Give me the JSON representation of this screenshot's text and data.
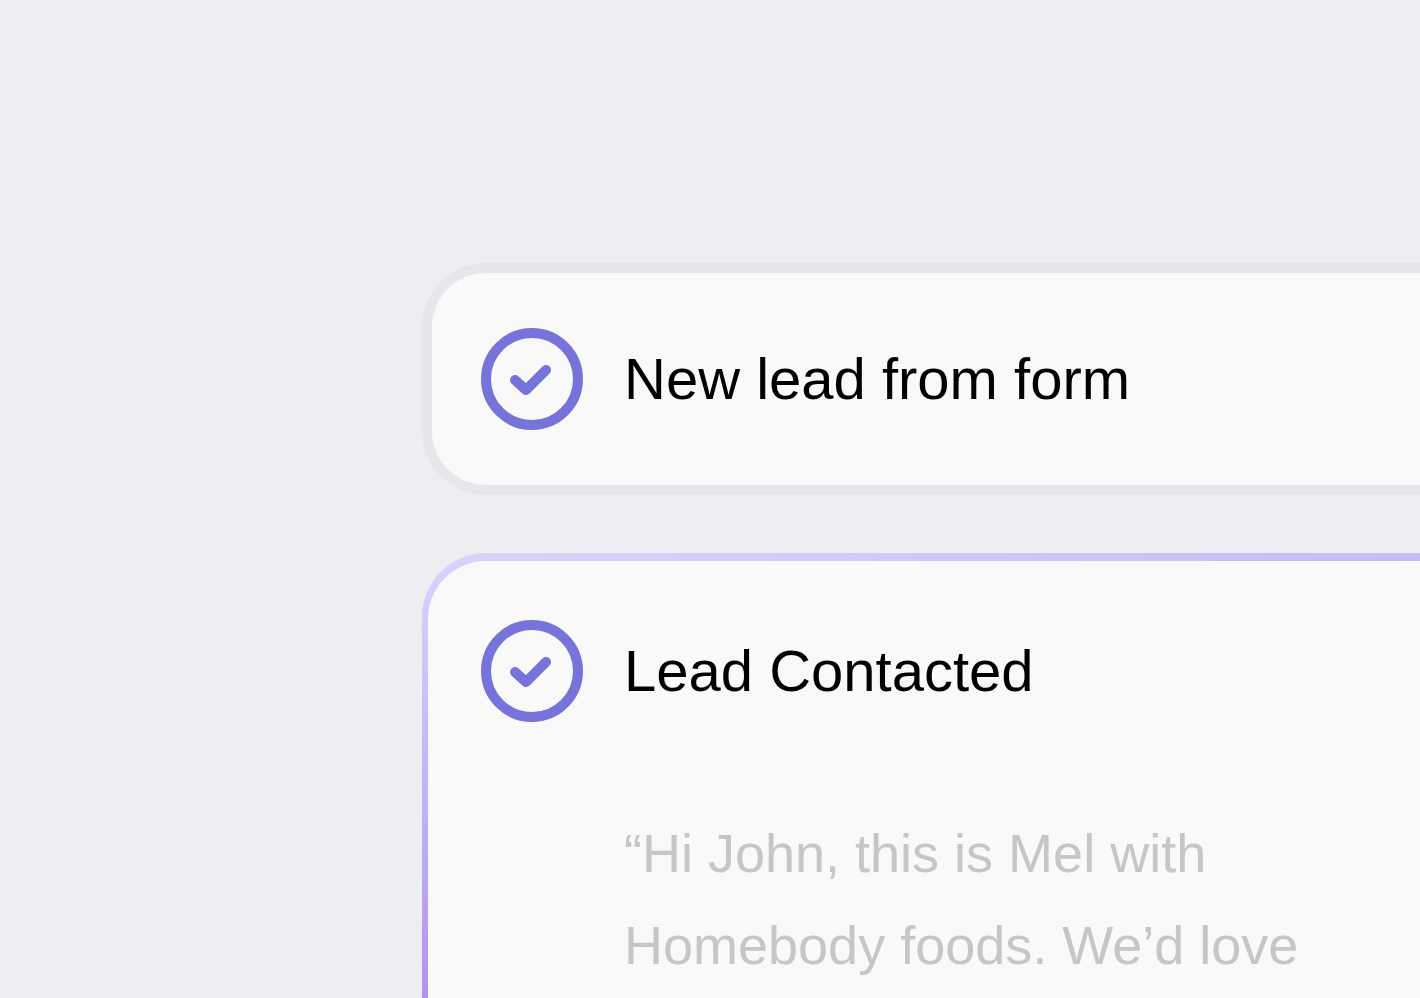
{
  "steps": [
    {
      "title": "New lead from form",
      "completed": true,
      "selected": false
    },
    {
      "title": "Lead Contacted",
      "completed": true,
      "selected": true,
      "message": "“Hi John, this is Mel with Homebody foods. We’d love"
    }
  ]
}
